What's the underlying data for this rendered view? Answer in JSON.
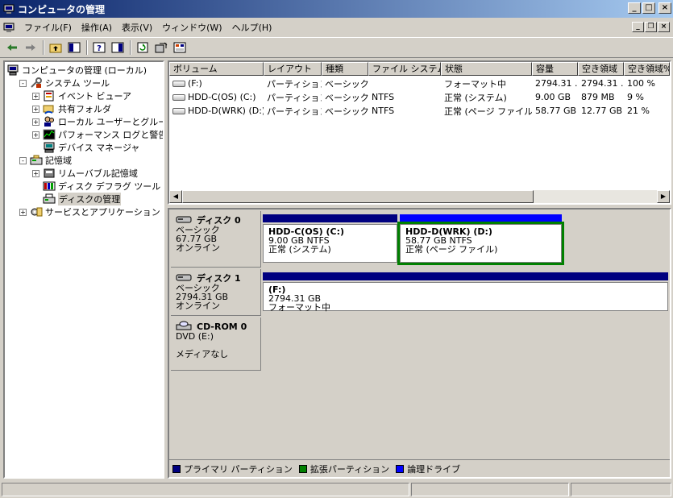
{
  "window": {
    "title": "コンピュータの管理"
  },
  "menu": [
    "ファイル(F)",
    "操作(A)",
    "表示(V)",
    "ウィンドウ(W)",
    "ヘルプ(H)"
  ],
  "tree": [
    {
      "label": "コンピュータの管理 (ローカル)",
      "level": 0,
      "expander": "",
      "icon": "computer-icon"
    },
    {
      "label": "システム ツール",
      "level": 1,
      "expander": "−",
      "icon": "tools-icon"
    },
    {
      "label": "イベント ビューア",
      "level": 2,
      "expander": "+",
      "icon": "event-viewer-icon"
    },
    {
      "label": "共有フォルダ",
      "level": 2,
      "expander": "+",
      "icon": "shared-folder-icon"
    },
    {
      "label": "ローカル ユーザーとグループ",
      "level": 2,
      "expander": "+",
      "icon": "users-icon"
    },
    {
      "label": "パフォーマンス ログと警告",
      "level": 2,
      "expander": "+",
      "icon": "performance-icon"
    },
    {
      "label": "デバイス マネージャ",
      "level": 2,
      "expander": "",
      "icon": "device-manager-icon"
    },
    {
      "label": "記憶域",
      "level": 1,
      "expander": "−",
      "icon": "storage-icon"
    },
    {
      "label": "リムーバブル記憶域",
      "level": 2,
      "expander": "+",
      "icon": "removable-storage-icon"
    },
    {
      "label": "ディスク デフラグ ツール",
      "level": 2,
      "expander": "",
      "icon": "defrag-icon"
    },
    {
      "label": "ディスクの管理",
      "level": 2,
      "expander": "",
      "icon": "disk-management-icon",
      "selected": true
    },
    {
      "label": "サービスとアプリケーション",
      "level": 1,
      "expander": "+",
      "icon": "services-icon"
    }
  ],
  "volumes": {
    "columns": [
      "ボリューム",
      "レイアウト",
      "種類",
      "ファイル システム",
      "状態",
      "容量",
      "空き領域",
      "空き領域%"
    ],
    "rows": [
      [
        "(F:)",
        "パーティション",
        "ベーシック",
        "",
        "フォーマット中",
        "2794.31 ...",
        "2794.31 ...",
        "100 %"
      ],
      [
        "HDD-C(OS) (C:)",
        "パーティション",
        "ベーシック",
        "NTFS",
        "正常 (システム)",
        "9.00 GB",
        "879 MB",
        "9 %"
      ],
      [
        "HDD-D(WRK) (D:)",
        "パーティション",
        "ベーシック",
        "NTFS",
        "正常 (ページ ファイル)",
        "58.77 GB",
        "12.77 GB",
        "21 %"
      ]
    ]
  },
  "disks": [
    {
      "name": "ディスク 0",
      "type": "ベーシック",
      "size": "67.77 GB",
      "status": "オンライン",
      "partitions": [
        {
          "name": "HDD-C(OS)  (C:)",
          "size": "9.00 GB NTFS",
          "status": "正常 (システム)",
          "kind": "primary"
        },
        {
          "name": "HDD-D(WRK)  (D:)",
          "size": "58.77 GB NTFS",
          "status": "正常 (ページ ファイル)",
          "kind": "logical",
          "selected": true
        }
      ]
    },
    {
      "name": "ディスク 1",
      "type": "ベーシック",
      "size": "2794.31 GB",
      "status": "オンライン",
      "partitions": [
        {
          "name": "(F:)",
          "size": "2794.31 GB",
          "status": "フォーマット中",
          "kind": "primary"
        }
      ]
    },
    {
      "name": "CD-ROM 0",
      "type": "DVD (E:)",
      "size": "",
      "status": "メディアなし",
      "partitions": []
    }
  ],
  "legend": [
    {
      "label": "プライマリ パーティション",
      "color": "#000080"
    },
    {
      "label": "拡張パーティション",
      "color": "#008000"
    },
    {
      "label": "論理ドライブ",
      "color": "#0000ff"
    }
  ]
}
